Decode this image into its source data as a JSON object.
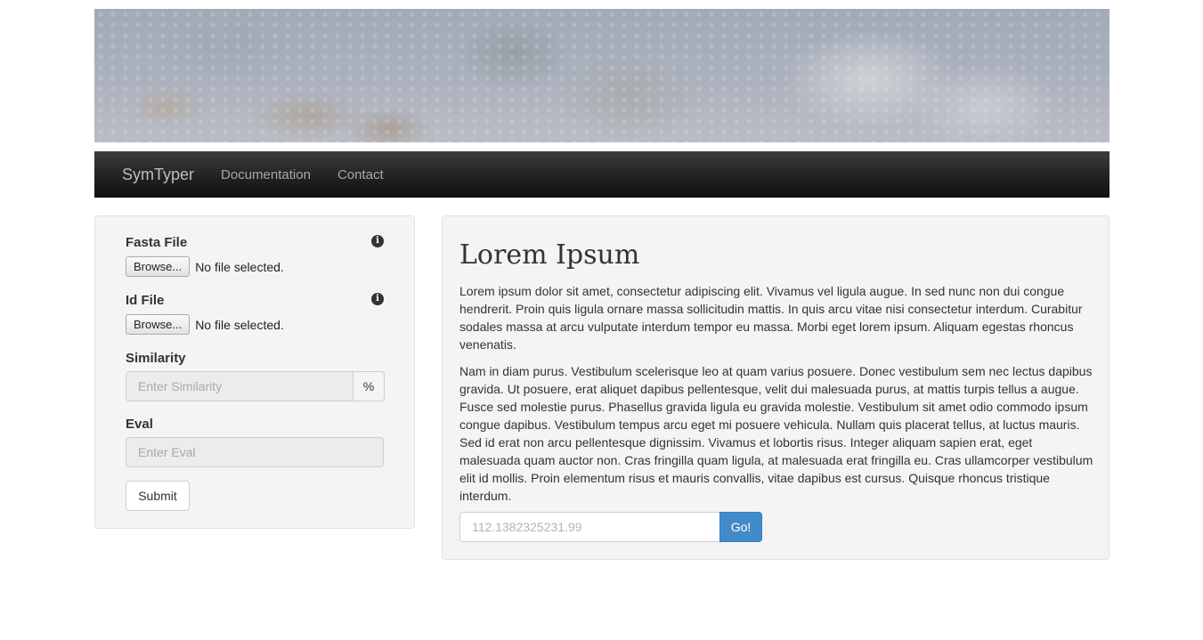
{
  "banner": {
    "image_alt": "coral reef"
  },
  "navbar": {
    "brand": "SymTyper",
    "links": [
      "Documentation",
      "Contact"
    ]
  },
  "form": {
    "fasta_label": "Fasta File",
    "id_label": "Id File",
    "browse_label": "Browse...",
    "no_file_text": "No file selected.",
    "similarity_label": "Similarity",
    "similarity_placeholder": "Enter Similarity",
    "similarity_addon": "%",
    "eval_label": "Eval",
    "eval_placeholder": "Enter Eval",
    "submit_label": "Submit",
    "info_icon_glyph": "i"
  },
  "content": {
    "title": "Lorem Ipsum",
    "paragraph1": "Lorem ipsum dolor sit amet, consectetur adipiscing elit. Vivamus vel ligula augue. In sed nunc non dui congue hendrerit. Proin quis ligula ornare massa sollicitudin mattis. In quis arcu vitae nisi consectetur interdum. Curabitur sodales massa at arcu vulputate interdum tempor eu massa. Morbi eget lorem ipsum. Aliquam egestas rhoncus venenatis.",
    "paragraph2": "Nam in diam purus. Vestibulum scelerisque leo at quam varius posuere. Donec vestibulum sem nec lectus dapibus gravida. Ut posuere, erat aliquet dapibus pellentesque, velit dui malesuada purus, at mattis turpis tellus a augue. Fusce sed molestie purus. Phasellus gravida ligula eu gravida molestie. Vestibulum sit amet odio commodo ipsum congue dapibus. Vestibulum tempus arcu eget mi posuere vehicula. Nullam quis placerat tellus, at luctus mauris. Sed id erat non arcu pellentesque dignissim. Vivamus et lobortis risus. Integer aliquam sapien erat, eget malesuada quam auctor non. Cras fringilla quam ligula, at malesuada erat fringilla eu. Cras ullamcorper vestibulum elit id mollis. Proin elementum risus et mauris convallis, vitae dapibus est cursus. Quisque rhoncus tristique interdum.",
    "go_placeholder": "112.1382325231.99",
    "go_label": "Go!"
  },
  "colors": {
    "navbar": "#222222",
    "panel_bg": "#f4f4f4",
    "go_button": "#428bca"
  }
}
